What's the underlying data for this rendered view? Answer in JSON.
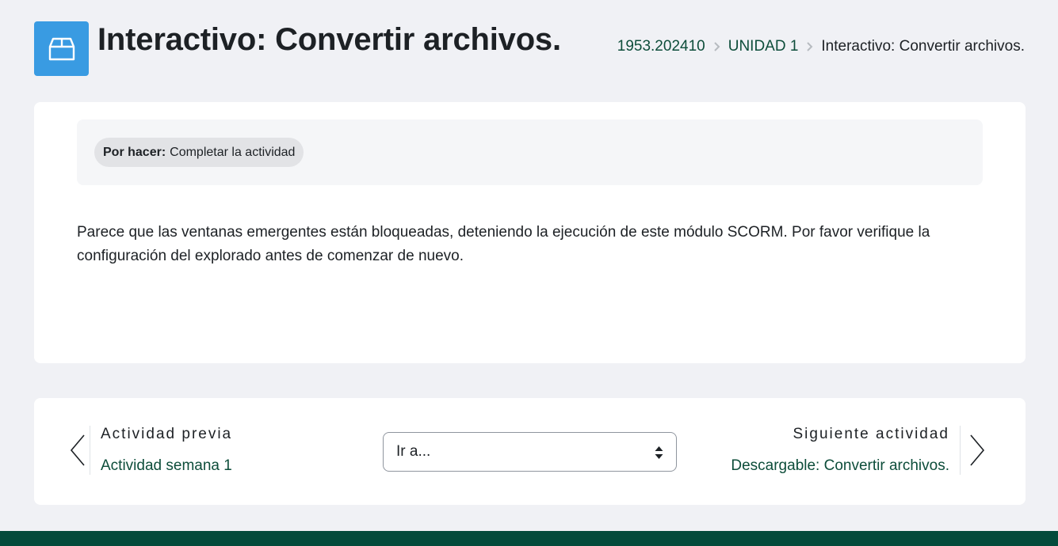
{
  "header": {
    "title": "Interactivo: Convertir archivos.",
    "icon": "package-box-icon",
    "icon_bg": "#399be2"
  },
  "breadcrumb": {
    "items": [
      {
        "label": "1953.202410"
      },
      {
        "label": "UNIDAD 1"
      },
      {
        "label": "Interactivo: Convertir archivos."
      }
    ],
    "link_color": "#0d4d3a"
  },
  "completion": {
    "label": "Por hacer:",
    "value": "Completar la actividad"
  },
  "notice": {
    "text": "Parece que las ventanas emergentes están bloqueadas, deteniendo la ejecución de este módulo SCORM. Por favor verifique la configuración del explorado antes de comenzar de nuevo."
  },
  "navigation": {
    "prev": {
      "heading": "Actividad previa",
      "title": "Actividad semana 1"
    },
    "jump": {
      "selected": "Ir a..."
    },
    "next": {
      "heading": "Siguiente actividad",
      "title": "Descargable: Convertir archivos."
    }
  },
  "footer": {
    "color": "#034b3b"
  }
}
